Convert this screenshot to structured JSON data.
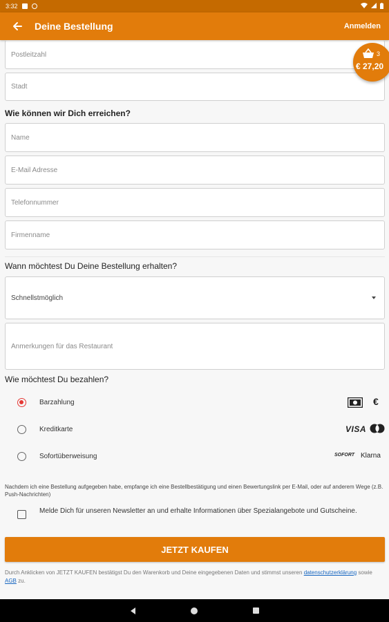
{
  "status_bar": {
    "time": "3:32"
  },
  "app_bar": {
    "title": "Deine Bestellung",
    "login_label": "Anmelden"
  },
  "cart": {
    "count": "3",
    "total": "€ 27,20"
  },
  "address": {
    "zip_placeholder": "Postleitzahl",
    "city_placeholder": "Stadt"
  },
  "contact": {
    "heading": "Wie können wir Dich erreichen?",
    "name_placeholder": "Name",
    "email_placeholder": "E-Mail Adresse",
    "phone_placeholder": "Telefonnummer",
    "company_placeholder": "Firmenname"
  },
  "delivery": {
    "heading": "Wann möchtest Du Deine Bestellung erhalten?",
    "time_selected": "Schnellstmöglich",
    "notes_placeholder": "Anmerkungen für das Restaurant"
  },
  "payment": {
    "heading": "Wie möchtest Du bezahlen?",
    "options": [
      {
        "label": "Barzahlung",
        "selected": true,
        "icons": [
          "cash-icon",
          "euro-icon"
        ]
      },
      {
        "label": "Kreditkarte",
        "selected": false,
        "icons": [
          "visa-logo",
          "mastercard-logo"
        ]
      },
      {
        "label": "Sofortüberweisung",
        "selected": false,
        "icons": [
          "sofort-logo",
          "klarna-logo"
        ]
      }
    ],
    "euro_symbol": "€",
    "visa_text": "VISA",
    "sofort_text": "SOFORT",
    "klarna_text": "Klarna"
  },
  "info_text": "Nachdem ich eine Bestellung aufgegeben habe, empfange ich eine Bestellbestätigung und einen Bewertungslink per E-Mail, oder auf anderem Wege (z.B. Push-Nachrichten)",
  "newsletter": {
    "label": "Melde Dich für unseren Newsletter an und erhalte Informationen über Spezialangebote und Gutscheine.",
    "checked": false
  },
  "buy_button": {
    "label": "JETZT KAUFEN"
  },
  "legal": {
    "prefix": "Durch Anklicken von JETZT KAUFEN bestätigst Du den Warenkorb und Deine eingegebenen Daten und stimmst unseren",
    "privacy_link": "datenschutzerklärung",
    "middle": "sowie",
    "terms_link": "AGB",
    "suffix": "zu."
  }
}
